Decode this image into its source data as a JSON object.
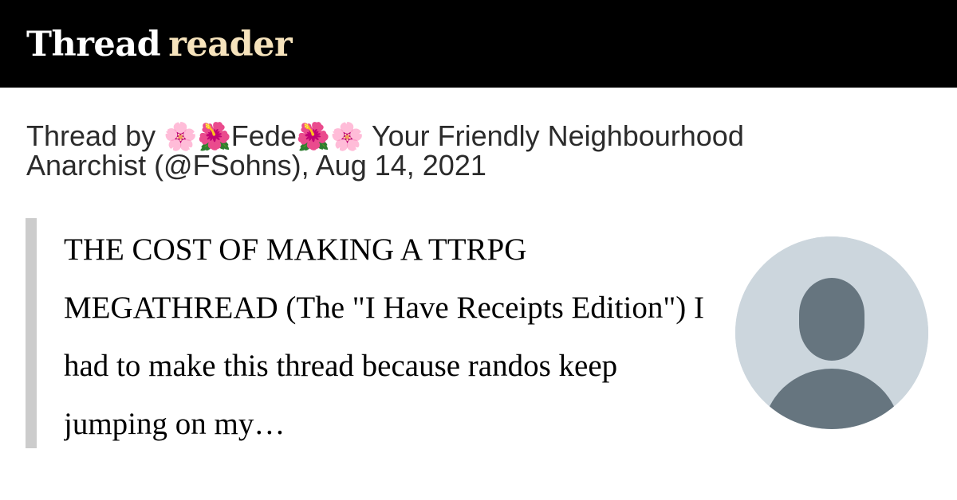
{
  "header": {
    "brand_thread": "Thread",
    "brand_reader": "reader",
    "colors": {
      "bar": "#000000",
      "thread": "#ffffff",
      "reader": "#f6e3bc"
    }
  },
  "byline": {
    "prefix": "Thread by",
    "emoji_1": "🌸🌺",
    "name": "Fede",
    "emoji_2": "🌺🌸",
    "rest": " Your Friendly Neighbourhood Anarchist (@FSohns), Aug 14, 2021"
  },
  "tweet": {
    "text": "THE COST OF MAKING A TTRPG MEGATHREAD (The \"I Have Receipts Edition\") I had to make this thread because randos keep jumping on my…"
  },
  "avatar": {
    "icon": "default-profile-icon",
    "colors": {
      "background": "#ccd6dd",
      "figure": "#66757f"
    }
  }
}
